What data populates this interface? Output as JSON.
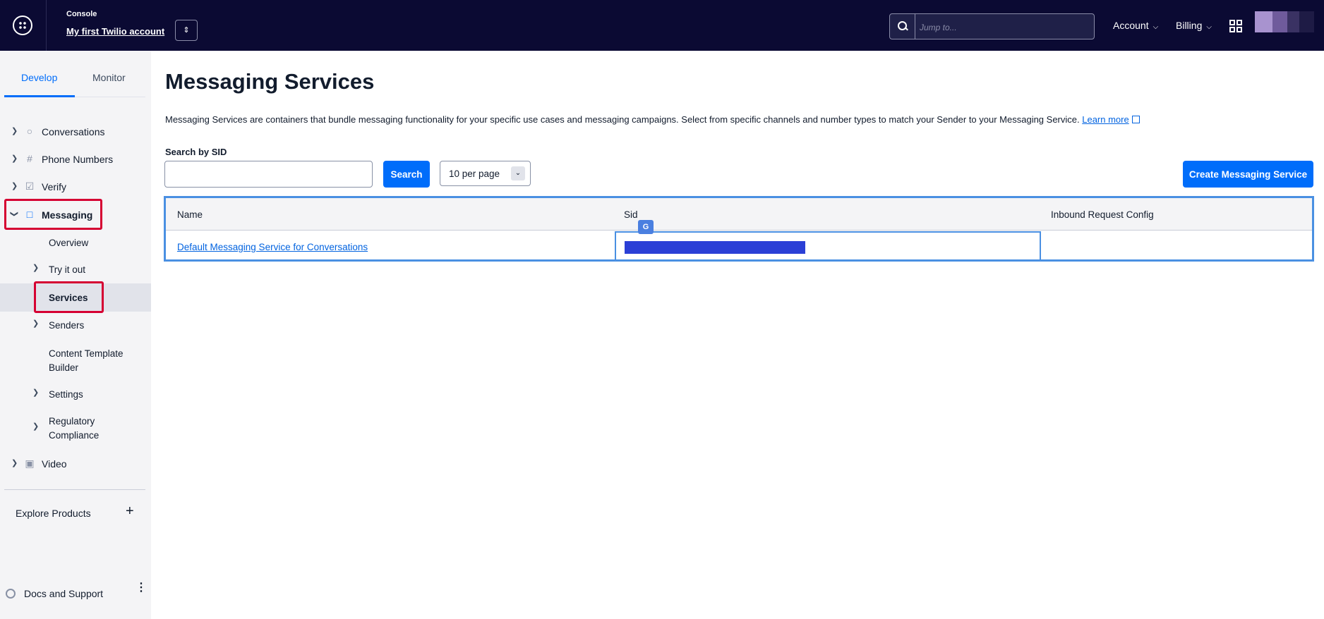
{
  "topbar": {
    "console_label": "Console",
    "account_name": "My first Twilio account",
    "jump_placeholder": "Jump to...",
    "account_menu": "Account",
    "billing_menu": "Billing",
    "icons": [
      "app-menu-icon",
      "switch-account-icon",
      "search-icon",
      "apps-grid-icon",
      "avatar"
    ]
  },
  "sidebar": {
    "tabs": [
      "Develop",
      "Monitor"
    ],
    "active_tab": "Develop",
    "items": [
      {
        "label": "Conversations",
        "icon": "conversations-icon"
      },
      {
        "label": "Phone Numbers",
        "icon": "hash-icon"
      },
      {
        "label": "Verify",
        "icon": "verify-icon"
      },
      {
        "label": "Messaging",
        "icon": "message-icon",
        "expanded": true
      },
      {
        "label": "Video",
        "icon": "video-icon"
      }
    ],
    "messaging_children": [
      {
        "label": "Overview"
      },
      {
        "label": "Try it out"
      },
      {
        "label": "Services",
        "active": true
      },
      {
        "label": "Senders"
      },
      {
        "label": "Content Template Builder"
      },
      {
        "label": "Settings"
      },
      {
        "label": "Regulatory Compliance"
      }
    ],
    "explore": "Explore Products",
    "plus": "+",
    "docs": "Docs and Support"
  },
  "main": {
    "title": "Messaging Services",
    "description": "Messaging Services are containers that bundle messaging functionality for your specific use cases and messaging campaigns. Select from specific channels and number types to match your Sender to your Messaging Service.",
    "learn_more": "Learn more",
    "search_label": "Search by SID",
    "search_value": "",
    "search_button": "Search",
    "per_page": "10 per page",
    "create_button": "Create Messaging Service",
    "table": {
      "columns": [
        "Name",
        "Sid",
        "Inbound Request Config"
      ],
      "rows": [
        {
          "name": "Default Messaging Service for Conversations",
          "sid": "",
          "inbound": ""
        }
      ]
    }
  },
  "colors": {
    "topbar_bg": "#0b0a33",
    "primary": "#006dfa",
    "highlight_red": "#d50032",
    "link": "#0263e0"
  }
}
